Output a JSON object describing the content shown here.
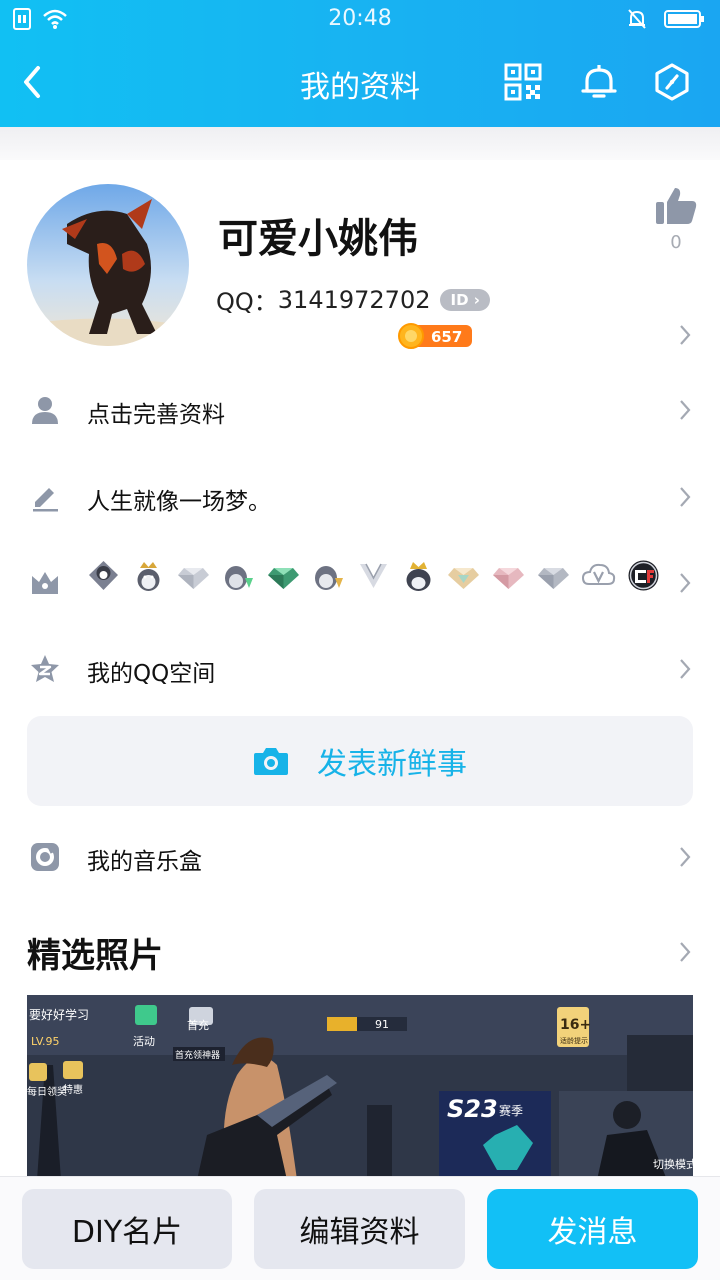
{
  "status_bar": {
    "time": "20:48"
  },
  "header": {
    "title": "我的资料"
  },
  "profile": {
    "name": "可爱小姚伟",
    "qq_label": "QQ：",
    "qq_number": "3141972702",
    "id_badge": "ID",
    "coin_value": "657",
    "like_count": "0"
  },
  "rows": {
    "complete_profile": "点击完善资料",
    "signature": "人生就像一场梦。",
    "qzone": "我的QQ空间",
    "music_box": "我的音乐盒"
  },
  "badges": [
    "penguin-rank-icon",
    "penguin-crown-icon",
    "diamond-icon",
    "penguin-diamond-icon",
    "emerald-icon",
    "penguin-gold-icon",
    "v-wings-icon",
    "penguin-king-icon",
    "gold-diamond-icon",
    "pink-diamond-icon",
    "silver-diamond-icon",
    "cloud-v-icon",
    "cf-logo-icon"
  ],
  "post": {
    "label": "发表新鲜事"
  },
  "featured": {
    "title": "精选照片"
  },
  "photo_text": {
    "study": "要好好学习",
    "level": "LV.95",
    "activity": "活动",
    "first_charge": "首充",
    "first_charge_sub": "首充领神器",
    "daily": "每日领奖",
    "special": "特惠",
    "gold_value": "91",
    "age_rating": "16+",
    "age_sub": "适龄提示",
    "season": "S23",
    "season_suffix": "赛季",
    "switch_mode": "切换模式"
  },
  "bottom_bar": {
    "diy": "DIY名片",
    "edit": "编辑资料",
    "message": "发消息"
  },
  "colors": {
    "header": "#14b8f2",
    "accent": "#17b3e8",
    "send_button": "#12c0f6"
  }
}
